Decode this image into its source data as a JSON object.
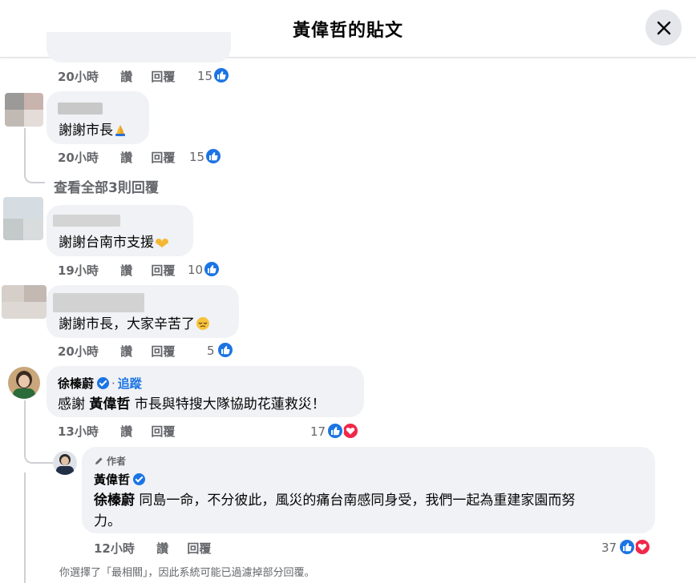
{
  "dialog": {
    "title": "黃偉哲的貼文"
  },
  "comments": [
    {
      "meta": {
        "time": "20小時",
        "like": "讚",
        "reply": "回覆"
      },
      "reactions": "15"
    },
    {
      "text": "謝謝市長",
      "meta": {
        "time": "20小時",
        "like": "讚",
        "reply": "回覆"
      },
      "reactions": "15"
    },
    {
      "view_replies": "查看全部3則回覆"
    },
    {
      "text": "謝謝台南市支援",
      "meta": {
        "time": "19小時",
        "like": "讚",
        "reply": "回覆"
      },
      "reactions": "10"
    },
    {
      "text": "謝謝市長，大家辛苦了",
      "meta": {
        "time": "20小時",
        "like": "讚",
        "reply": "回覆"
      },
      "reactions": "5"
    },
    {
      "author": "徐榛蔚",
      "follow": "追蹤",
      "text_pre": "感謝 ",
      "mention": "黃偉哲",
      "text_post": " 市長與特搜大隊協助花蓮救災！",
      "meta": {
        "time": "13小時",
        "like": "讚",
        "reply": "回覆"
      },
      "reactions": "17"
    },
    {
      "author_badge": "作者",
      "author": "黃偉哲",
      "mention": "徐榛蔚",
      "text_line1": " 同島一命，不分彼此，風災的痛台南感同身受，我們一起為重建家園而努",
      "text_line2": "力。",
      "meta": {
        "time": "12小時",
        "like": "讚",
        "reply": "回覆"
      },
      "reactions": "37"
    }
  ],
  "footer_note": "你選擇了「最相關」，因此系統可能已過濾掉部分回覆。",
  "colors": {
    "like_blue": "#1b74e4",
    "heart_red": "#f02849",
    "bubble": "#f0f2f5"
  }
}
